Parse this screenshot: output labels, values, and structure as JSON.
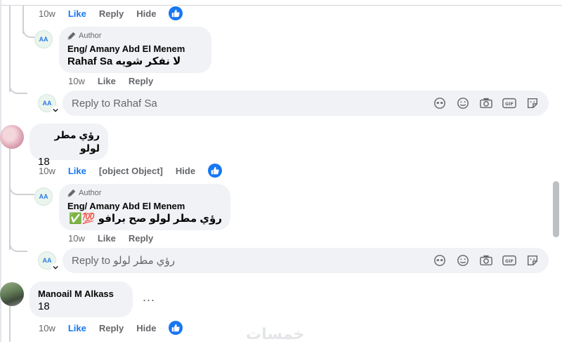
{
  "top_actions": {
    "time": "10w",
    "like": "Like",
    "reply": "Reply",
    "hide": "Hide"
  },
  "thread1": {
    "reply": {
      "badge": "Author",
      "name": "Eng/ Amany Abd El Menem",
      "mention": "Rahaf Sa",
      "text": "لا نفكر شويه",
      "time": "10w",
      "like": "Like",
      "reply": "Reply"
    },
    "reply_input": {
      "placeholder": "Reply to Rahaf Sa"
    }
  },
  "comment2": {
    "text": "رؤي مطر لولو",
    "number": "18",
    "time": "10w",
    "like": "Like",
    "reply": {
      "badge": "Author",
      "name": "Eng/ Amany Abd El Menem",
      "text": "رؤي مطر لولو صح برافو 💯✅",
      "time": "10w",
      "like": "Like",
      "reply": "Reply"
    },
    "hide": "Hide",
    "reply_input": {
      "placeholder": "Reply to رؤي مطر لولو"
    }
  },
  "comment3": {
    "name": "Manoail M Alkass",
    "number": "18",
    "more": "...",
    "time": "10w",
    "like": "Like",
    "reply": "Reply",
    "hide": "Hide"
  },
  "page_avatar_text": "AA",
  "watermark": "خمسات",
  "colors": {
    "accent": "#1877f2",
    "bubble": "#f0f2f5",
    "muted": "#65676b",
    "line": "#ced0d4"
  },
  "icons": [
    "thumbs-up-icon",
    "pencil-icon",
    "avatar-sticker-icon",
    "emoji-icon",
    "camera-icon",
    "gif-icon",
    "sticker-icon",
    "chevron-down-icon"
  ]
}
